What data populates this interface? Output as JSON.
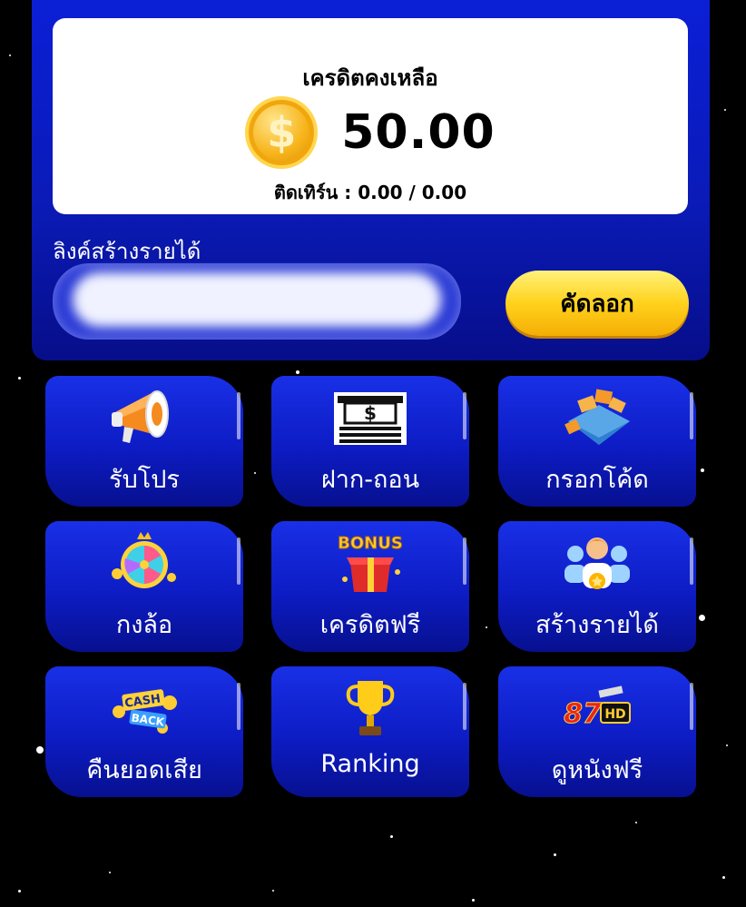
{
  "balance": {
    "title": "เครดิตคงเหลือ",
    "amount": "50.00",
    "turnover": "ติดเทิร์น : 0.00 / 0.00"
  },
  "referral": {
    "label": "ลิงค์สร้างรายได้",
    "copy_button": "คัดลอก"
  },
  "menu": [
    {
      "label": "รับโปร",
      "icon": "megaphone-icon"
    },
    {
      "label": "ฝาก-ถอน",
      "icon": "atm-cash-icon"
    },
    {
      "label": "กรอกโค้ด",
      "icon": "coupon-envelope-icon"
    },
    {
      "label": "กงล้อ",
      "icon": "prize-wheel-icon"
    },
    {
      "label": "เครดิตฟรี",
      "icon": "bonus-gift-icon"
    },
    {
      "label": "สร้างรายได้",
      "icon": "team-people-icon"
    },
    {
      "label": "คืนยอดเสีย",
      "icon": "cashback-icon"
    },
    {
      "label": "Ranking",
      "icon": "trophy-icon"
    },
    {
      "label": "ดูหนังฟรี",
      "icon": "movie-hd-icon"
    }
  ],
  "icon_texts": {
    "dollar": "$",
    "atm_dollar": "$",
    "bonus": "BONUS",
    "cash": "CASH",
    "back": "BACK",
    "movie_num": "87",
    "hd": "HD"
  },
  "colors": {
    "panel_blue": "#0b1fd6",
    "tile_blue": "#1930e6",
    "button_yellow": "#ffd21c",
    "coin_gold": "#f7b41a"
  }
}
